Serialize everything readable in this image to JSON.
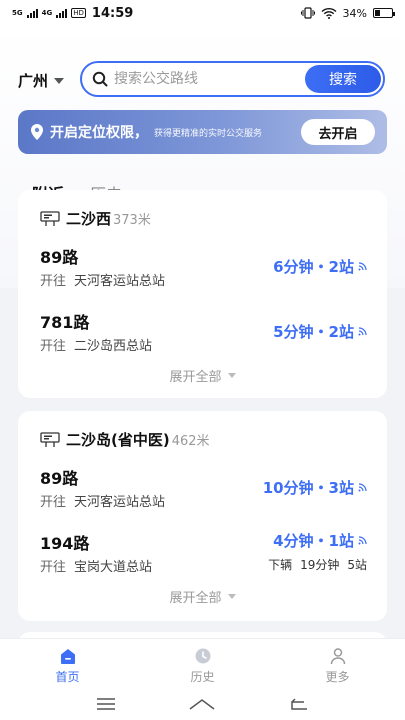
{
  "status_bar": {
    "network_1": "5G",
    "network_2": "4G",
    "hd": "HD",
    "time": "14:59",
    "battery": "34%",
    "battery_level": 0.34
  },
  "header": {
    "city": "广州",
    "search_placeholder": "搜索公交路线",
    "search_button": "搜索"
  },
  "location_banner": {
    "title": "开启定位权限，",
    "subtitle": "获得更精准的实时公交服务",
    "button": "去开启"
  },
  "tabs": [
    {
      "label": "附近",
      "active": true
    },
    {
      "label": "历史",
      "active": false
    }
  ],
  "stops": [
    {
      "name": "二沙西",
      "distance": "373米",
      "expand_label": "展开全部",
      "routes": [
        {
          "number": "89路",
          "dest_label": "开往",
          "destination": "天河客运站总站",
          "eta": "6分钟・2站"
        },
        {
          "number": "781路",
          "dest_label": "开往",
          "destination": "二沙岛西总站",
          "eta": "5分钟・2站"
        }
      ]
    },
    {
      "name": "二沙岛(省中医)",
      "distance": "462米",
      "expand_label": "展开全部",
      "routes": [
        {
          "number": "89路",
          "dest_label": "开往",
          "destination": "天河客运站总站",
          "eta": "10分钟・3站"
        },
        {
          "number": "194路",
          "dest_label": "开往",
          "destination": "宝岗大道总站",
          "eta": "4分钟・1站",
          "next_label": "下辆",
          "next_time": "19分钟",
          "next_stops": "5站"
        }
      ]
    }
  ],
  "bottom_nav": [
    {
      "label": "首页",
      "icon": "home-icon",
      "active": true
    },
    {
      "label": "历史",
      "icon": "clock-icon",
      "active": false
    },
    {
      "label": "更多",
      "icon": "user-icon",
      "active": false
    }
  ],
  "colors": {
    "accent": "#3d6ef5",
    "banner": "#6f88d0"
  }
}
